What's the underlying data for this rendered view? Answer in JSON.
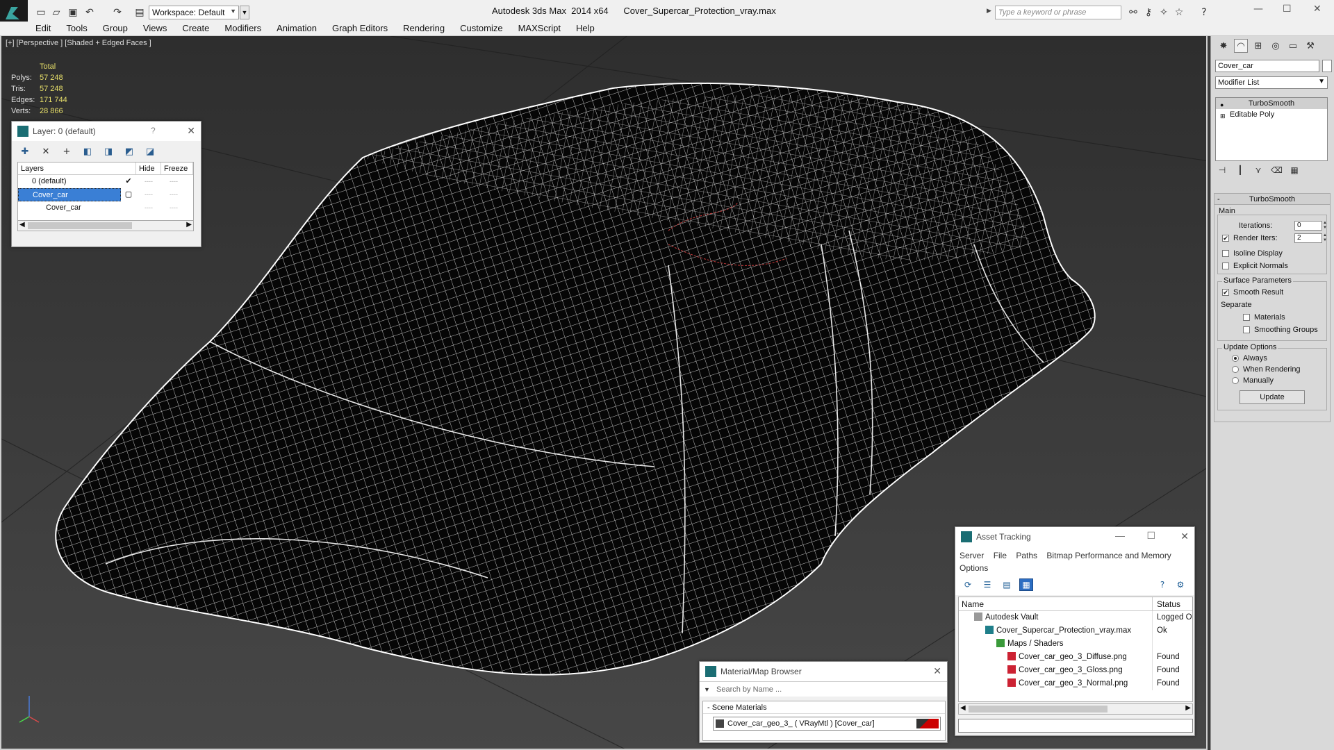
{
  "titlebar": {
    "workspace": "Workspace: Default",
    "app_title": "Autodesk 3ds Max  2014 x64      Cover_Supercar_Protection_vray.max",
    "search_placeholder": "Type a keyword or phrase"
  },
  "menu": [
    "Edit",
    "Tools",
    "Group",
    "Views",
    "Create",
    "Modifiers",
    "Animation",
    "Graph Editors",
    "Rendering",
    "Customize",
    "MAXScript",
    "Help"
  ],
  "viewport": {
    "label": "[+] [Perspective ] [Shaded + Edged Faces ]",
    "stats_header": "Total",
    "stats": [
      {
        "label": "Polys:",
        "value": "57 248"
      },
      {
        "label": "Tris:",
        "value": "57 248"
      },
      {
        "label": "Edges:",
        "value": "171 744"
      },
      {
        "label": "Verts:",
        "value": "28 866"
      }
    ],
    "wire_color": "#ffffff",
    "background_color": "#3f3f3f"
  },
  "layer_panel": {
    "title": "Layer: 0 (default)",
    "help": "?",
    "columns": {
      "layers": "Layers",
      "hide": "Hide",
      "freeze": "Freeze"
    },
    "rows": [
      {
        "name": "0 (default)"
      },
      {
        "name": "Cover_car"
      },
      {
        "name": "Cover_car"
      }
    ]
  },
  "command_panel": {
    "object_name": "Cover_car",
    "modifier_list": "Modifier List",
    "stack": [
      "TurboSmooth",
      "Editable Poly"
    ],
    "rollout_title": "TurboSmooth",
    "main_group": "Main",
    "iterations_label": "Iterations:",
    "iterations_value": "0",
    "render_iters_label": "Render Iters:",
    "render_iters_value": "2",
    "isoline": "Isoline Display",
    "explicit_normals": "Explicit Normals",
    "surface_group": "Surface Parameters",
    "smooth_result": "Smooth Result",
    "separate": "Separate",
    "materials": "Materials",
    "smoothing_groups": "Smoothing Groups",
    "update_group": "Update Options",
    "always": "Always",
    "when_rendering": "When Rendering",
    "manually": "Manually",
    "update_button": "Update"
  },
  "asset_panel": {
    "title": "Asset Tracking",
    "menu": [
      "Server",
      "File",
      "Paths",
      "Bitmap Performance and Memory",
      "Options"
    ],
    "columns": {
      "name": "Name",
      "status": "Status"
    },
    "rows": [
      {
        "name": "Autodesk Vault",
        "status": "Logged O",
        "indent": 1
      },
      {
        "name": "Cover_Supercar_Protection_vray.max",
        "status": "Ok",
        "indent": 2
      },
      {
        "name": "Maps / Shaders",
        "status": "",
        "indent": 3
      },
      {
        "name": "Cover_car_geo_3_Diffuse.png",
        "status": "Found",
        "indent": 4
      },
      {
        "name": "Cover_car_geo_3_Gloss.png",
        "status": "Found",
        "indent": 4
      },
      {
        "name": "Cover_car_geo_3_Normal.png",
        "status": "Found",
        "indent": 4
      }
    ]
  },
  "material_panel": {
    "title": "Material/Map Browser",
    "search_placeholder": "Search by Name ...",
    "group": "- Scene Materials",
    "item": "Cover_car_geo_3_  ( VRayMtl )  [Cover_car]",
    "swatch_color": "#cc0000"
  }
}
